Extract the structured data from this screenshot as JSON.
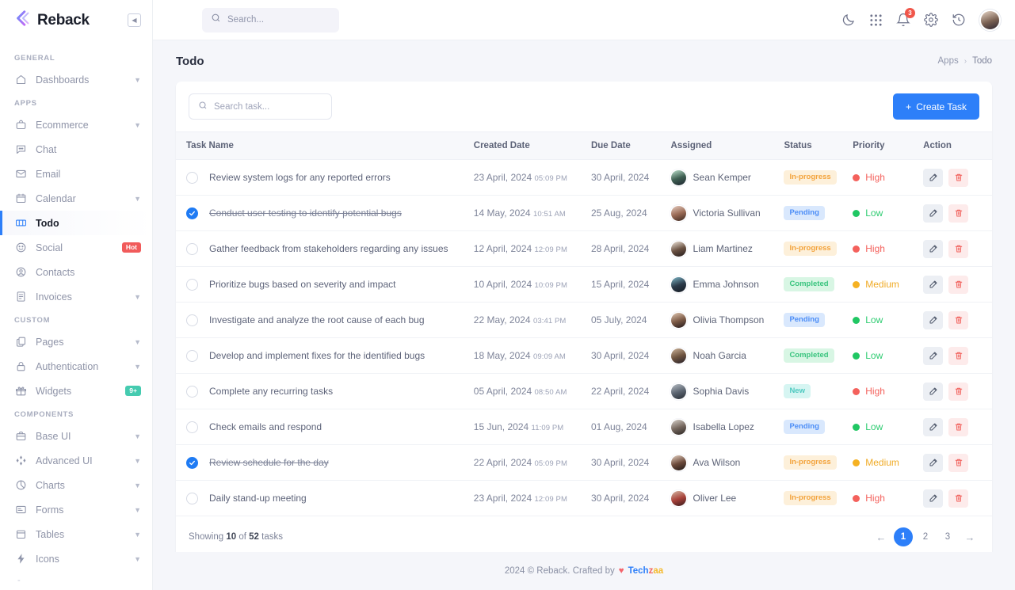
{
  "brand": {
    "name": "Reback",
    "logo_icon": "chevron-left-logo",
    "collapse_icon": "collapse-sidebar-icon"
  },
  "sidebar": {
    "groups": [
      {
        "title": "GENERAL",
        "items": [
          {
            "label": "Dashboards",
            "icon": "home-icon",
            "chevron": true
          }
        ]
      },
      {
        "title": "APPS",
        "items": [
          {
            "label": "Ecommerce",
            "icon": "bag-icon",
            "chevron": true
          },
          {
            "label": "Chat",
            "icon": "chat-icon",
            "chevron": false
          },
          {
            "label": "Email",
            "icon": "mail-icon",
            "chevron": false
          },
          {
            "label": "Calendar",
            "icon": "calendar-icon",
            "chevron": true
          },
          {
            "label": "Todo",
            "icon": "todo-icon",
            "chevron": false,
            "active": true
          },
          {
            "label": "Social",
            "icon": "smiley-icon",
            "chevron": false,
            "badge": "Hot",
            "badge_style": "hot"
          },
          {
            "label": "Contacts",
            "icon": "user-circle-icon",
            "chevron": false
          },
          {
            "label": "Invoices",
            "icon": "invoice-icon",
            "chevron": true
          }
        ]
      },
      {
        "title": "CUSTOM",
        "items": [
          {
            "label": "Pages",
            "icon": "copy-icon",
            "chevron": true
          },
          {
            "label": "Authentication",
            "icon": "lock-icon",
            "chevron": true
          },
          {
            "label": "Widgets",
            "icon": "gift-icon",
            "chevron": false,
            "badge": "9+",
            "badge_style": "nine"
          }
        ]
      },
      {
        "title": "COMPONENTS",
        "items": [
          {
            "label": "Base UI",
            "icon": "briefcase-icon",
            "chevron": true
          },
          {
            "label": "Advanced UI",
            "icon": "diamonds-icon",
            "chevron": true
          },
          {
            "label": "Charts",
            "icon": "pie-chart-icon",
            "chevron": true
          },
          {
            "label": "Forms",
            "icon": "form-icon",
            "chevron": true
          },
          {
            "label": "Tables",
            "icon": "table-icon",
            "chevron": true
          },
          {
            "label": "Icons",
            "icon": "bolt-icon",
            "chevron": true
          }
        ]
      }
    ]
  },
  "topbar": {
    "search_placeholder": "Search...",
    "search_value": "",
    "icons": [
      {
        "name": "moon-icon"
      },
      {
        "name": "grid-apps-icon"
      },
      {
        "name": "bell-icon",
        "badge": "3"
      },
      {
        "name": "gear-icon"
      },
      {
        "name": "history-icon"
      }
    ],
    "avatar": "user-avatar"
  },
  "page": {
    "title": "Todo",
    "breadcrumb": [
      "Apps",
      "Todo"
    ],
    "breadcrumb_sep": "›"
  },
  "toolbar": {
    "search_placeholder": "Search task...",
    "search_value": "",
    "create_label": "Create Task",
    "create_plus": "+"
  },
  "table": {
    "columns": [
      "Task Name",
      "Created Date",
      "Due Date",
      "Assigned",
      "Status",
      "Priority",
      "Action"
    ],
    "rows": [
      {
        "done": false,
        "task": "Review system logs for any reported errors",
        "created_date": "23 April, 2024",
        "created_time": "05:09 PM",
        "due": "30 April, 2024",
        "assignee": "Sean Kemper",
        "avatar_colors": [
          "#bfe3cf",
          "#3f5f52",
          "#1d2430"
        ],
        "status": "In-progress",
        "status_class": "inprogress",
        "priority": "High",
        "priority_class": "high"
      },
      {
        "done": true,
        "task": "Conduct user testing to identify potential bugs",
        "created_date": "14 May, 2024",
        "created_time": "10:51 AM",
        "due": "25 Aug, 2024",
        "assignee": "Victoria Sullivan",
        "avatar_colors": [
          "#e8cfc2",
          "#9a6a55",
          "#3a2720"
        ],
        "status": "Pending",
        "status_class": "pending",
        "priority": "Low",
        "priority_class": "low"
      },
      {
        "done": false,
        "task": "Gather feedback from stakeholders regarding any issues",
        "created_date": "12 April, 2024",
        "created_time": "12:09 PM",
        "due": "28 April, 2024",
        "assignee": "Liam Martinez",
        "avatar_colors": [
          "#f0e6dc",
          "#6b5243",
          "#22191a"
        ],
        "status": "In-progress",
        "status_class": "inprogress",
        "priority": "High",
        "priority_class": "high"
      },
      {
        "done": false,
        "task": "Prioritize bugs based on severity and impact",
        "created_date": "10 April, 2024",
        "created_time": "10:09 PM",
        "due": "15 April, 2024",
        "assignee": "Emma Johnson",
        "avatar_colors": [
          "#7fb9c9",
          "#2c3b4a",
          "#141a22"
        ],
        "status": "Completed",
        "status_class": "completed",
        "priority": "Medium",
        "priority_class": "medium"
      },
      {
        "done": false,
        "task": "Investigate and analyze the root cause of each bug",
        "created_date": "22 May, 2024",
        "created_time": "03:41 PM",
        "due": "05 July, 2024",
        "assignee": "Olivia Thompson",
        "avatar_colors": [
          "#e2c9b4",
          "#7c5a46",
          "#20181c"
        ],
        "status": "Pending",
        "status_class": "pending",
        "priority": "Low",
        "priority_class": "low"
      },
      {
        "done": false,
        "task": "Develop and implement fixes for the identified bugs",
        "created_date": "18 May, 2024",
        "created_time": "09:09 AM",
        "due": "30 April, 2024",
        "assignee": "Noah Garcia",
        "avatar_colors": [
          "#cdb49b",
          "#6f5540",
          "#262029"
        ],
        "status": "Completed",
        "status_class": "completed",
        "priority": "Low",
        "priority_class": "low"
      },
      {
        "done": false,
        "task": "Complete any recurring tasks",
        "created_date": "05 April, 2024",
        "created_time": "08:50 AM",
        "due": "22 April, 2024",
        "assignee": "Sophia Davis",
        "avatar_colors": [
          "#b9bfc6",
          "#5b6470",
          "#262b33"
        ],
        "status": "New",
        "status_class": "new",
        "priority": "High",
        "priority_class": "high"
      },
      {
        "done": false,
        "task": "Check emails and respond",
        "created_date": "15 Jun, 2024",
        "created_time": "11:09 PM",
        "due": "01 Aug, 2024",
        "assignee": "Isabella Lopez",
        "avatar_colors": [
          "#d8d2cc",
          "#75675e",
          "#2a2522"
        ],
        "status": "Pending",
        "status_class": "pending",
        "priority": "Low",
        "priority_class": "low"
      },
      {
        "done": true,
        "task": "Review schedule for the day",
        "created_date": "22 April, 2024",
        "created_time": "05:09 PM",
        "due": "30 April, 2024",
        "assignee": "Ava Wilson",
        "avatar_colors": [
          "#e7d3c4",
          "#6d4b3c",
          "#1e1716"
        ],
        "status": "In-progress",
        "status_class": "inprogress",
        "priority": "Medium",
        "priority_class": "medium"
      },
      {
        "done": false,
        "task": "Daily stand-up meeting",
        "created_date": "23 April, 2024",
        "created_time": "12:09 PM",
        "due": "30 April, 2024",
        "assignee": "Oliver Lee",
        "avatar_colors": [
          "#d4b8a4",
          "#a8423a",
          "#341a1c"
        ],
        "status": "In-progress",
        "status_class": "inprogress",
        "priority": "High",
        "priority_class": "high"
      }
    ],
    "action_icons": {
      "edit": "edit-pencil-icon",
      "delete": "trash-icon"
    }
  },
  "pagination": {
    "showing_prefix": "Showing",
    "showing_count": "10",
    "showing_mid": "of",
    "showing_total": "52",
    "showing_suffix": "tasks",
    "prev": "←",
    "next": "→",
    "pages": [
      "1",
      "2",
      "3"
    ],
    "current": "1"
  },
  "footer": {
    "text_left": "2024 © Reback. Crafted by",
    "heart": "♥",
    "brand_1": "Tech",
    "brand_2": "z",
    "brand_3": "aa"
  },
  "colors": {
    "accent": "#2d7ff9",
    "hot": "#f15b5b",
    "teal": "#45cbb0",
    "high": "#f4615c",
    "low": "#20c763",
    "medium": "#f5b122"
  }
}
